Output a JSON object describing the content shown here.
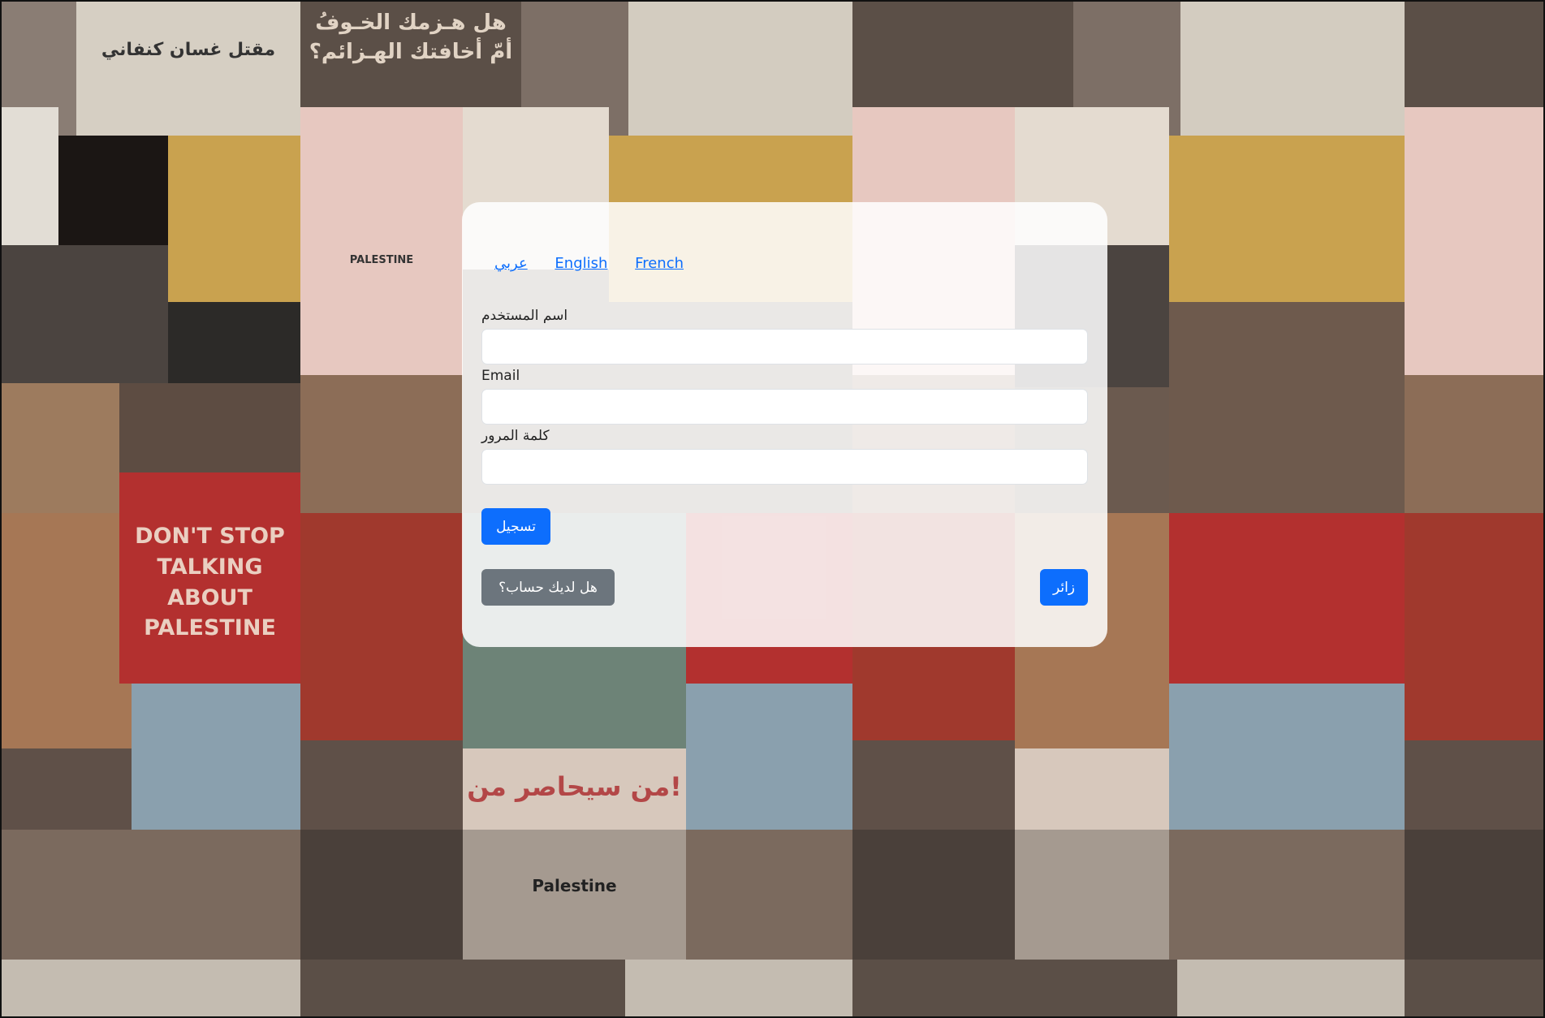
{
  "languages": {
    "arabic": "عربي",
    "english": "English",
    "french": "French"
  },
  "form": {
    "username_label": "اسم المستخدم",
    "username_value": "",
    "email_label": "Email",
    "email_value": "",
    "password_label": "كلمة المرور",
    "password_value": ""
  },
  "buttons": {
    "register": "تسجيل",
    "have_account": "هل لديك حساب؟",
    "visitor": "زائر"
  },
  "background": {
    "poster_headline": "هل هـزمك الخـوفُ أمّ أخافتك الهـزائم؟",
    "newspaper_headline": "مقتل غسان كنفاني",
    "slogan": "DON'T STOP TALKING ABOUT PALESTINE",
    "map_label": "PALESTINE",
    "street_sign": "Palestine",
    "graffiti": "من سيحاصر من!"
  },
  "colors": {
    "primary": "#0d6efd",
    "secondary": "#6c757d",
    "panel": "rgba(255,255,255,0.86)"
  }
}
